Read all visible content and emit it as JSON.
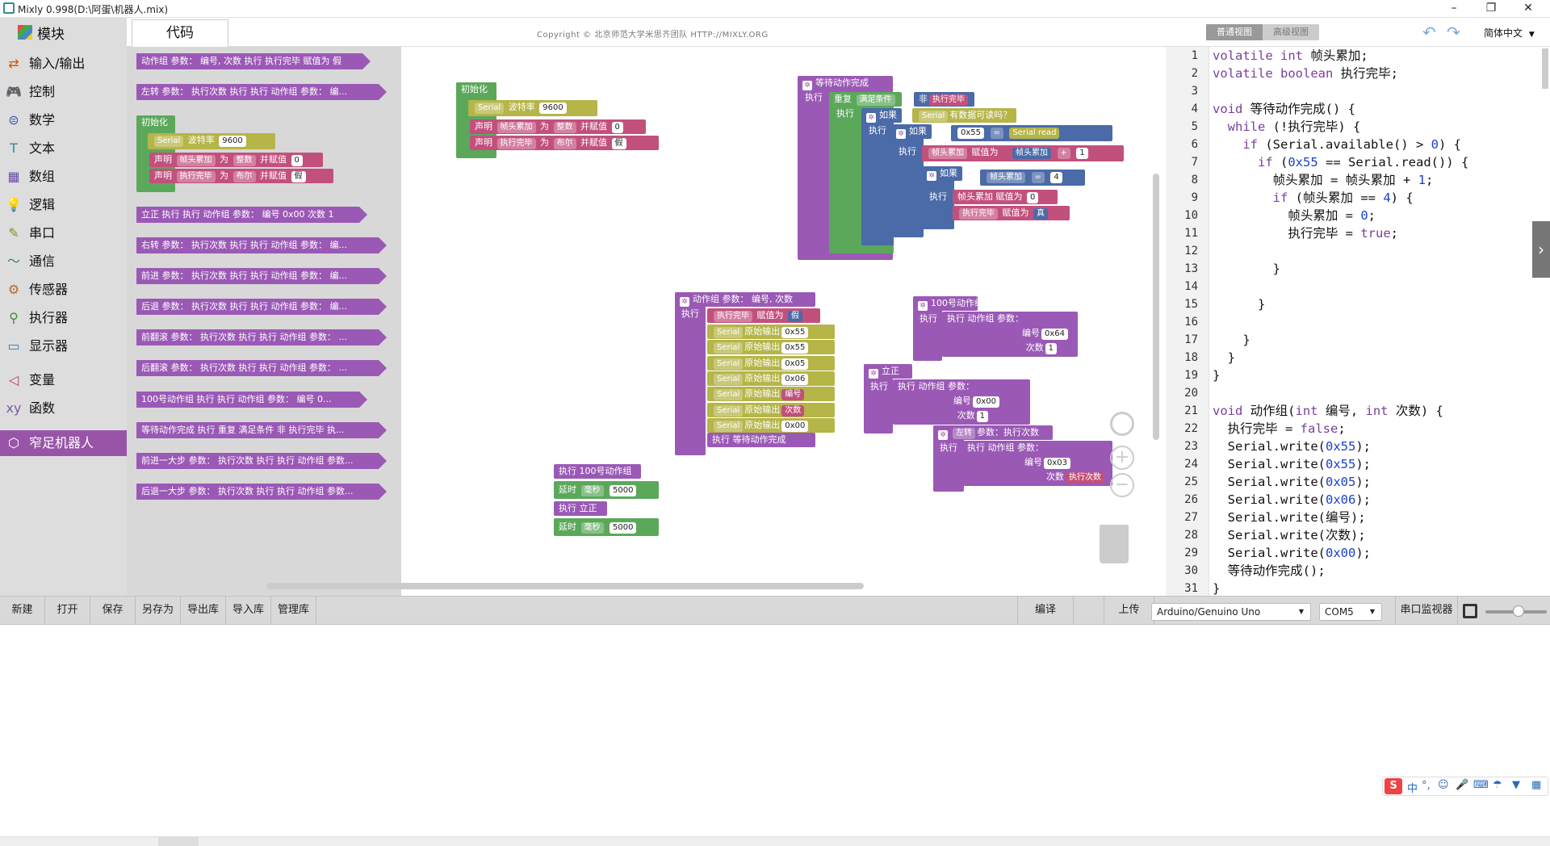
{
  "window": {
    "title": "Mixly 0.998(D:\\阿蛋\\机器人.mix)",
    "minimize": "–",
    "maximize": "❐",
    "close": "✕"
  },
  "tabs": {
    "blocks": "模块",
    "code": "代码",
    "copyright": "Copyright © 北京师范大学米思齐团队 HTTP://MIXLY.ORG",
    "normal_view": "普通视图",
    "advanced_view": "高级视图",
    "language": "简体中文"
  },
  "categories": [
    {
      "label": "输入/输出",
      "icon": "io-icon",
      "glyph": "⇄",
      "color": "#d35400"
    },
    {
      "label": "控制",
      "icon": "gamepad-icon",
      "glyph": "🎮",
      "color": "#3a8a3a"
    },
    {
      "label": "数学",
      "icon": "math-icon",
      "glyph": "⊜",
      "color": "#3a5aa8"
    },
    {
      "label": "文本",
      "icon": "text-icon",
      "glyph": "T",
      "color": "#3a8a8a"
    },
    {
      "label": "数组",
      "icon": "array-icon",
      "glyph": "▦",
      "color": "#6a4aa8"
    },
    {
      "label": "逻辑",
      "icon": "bulb-icon",
      "glyph": "💡",
      "color": "#3a6ab8"
    },
    {
      "label": "串口",
      "icon": "pen-icon",
      "glyph": "✎",
      "color": "#8a8a2a"
    },
    {
      "label": "通信",
      "icon": "wave-icon",
      "glyph": "〜",
      "color": "#2a8a5a"
    },
    {
      "label": "传感器",
      "icon": "sensor-icon",
      "glyph": "⚙",
      "color": "#b86a2a"
    },
    {
      "label": "执行器",
      "icon": "actuator-icon",
      "glyph": "⚲",
      "color": "#3a8a3a"
    },
    {
      "label": "显示器",
      "icon": "monitor-icon",
      "glyph": "▭",
      "color": "#3a7ab8"
    },
    {
      "label": "变量",
      "icon": "variable-icon",
      "glyph": "◁",
      "color": "#b83a5a"
    },
    {
      "label": "函数",
      "icon": "function-icon",
      "glyph": "xy",
      "color": "#7a5aa8"
    },
    {
      "label": "窄足机器人",
      "icon": "cube-icon",
      "glyph": "⬡",
      "color": "#ffffff"
    }
  ],
  "flyout": {
    "items": [
      "动作组 参数： 编号, 次数 执行 执行完毕 赋值为 假",
      "左转 参数： 执行次数 执行 执行 动作组 参数： 编...",
      "立正 执行 执行 动作组 参数： 编号 0x00 次数 1",
      "右转 参数： 执行次数 执行 执行 动作组 参数： 编...",
      "前进 参数： 执行次数 执行 执行 动作组 参数： 编...",
      "后退 参数： 执行次数 执行 执行 动作组 参数： 编...",
      "前翻滚 参数： 执行次数 执行 执行 动作组 参数： ...",
      "后翻滚 参数： 执行次数 执行 执行 动作组 参数： ...",
      "100号动作组 执行 执行 动作组 参数： 编号 0...",
      "等待动作完成 执行 重复 满足条件 非 执行完毕 执...",
      "前进一大步 参数： 执行次数 执行 执行 动作组 参数...",
      "后退一大步 参数： 执行次数 执行 执行 动作组 参数..."
    ],
    "init": {
      "title": "初始化",
      "serial": "Serial",
      "baud_label": "波特率",
      "baud": "9600",
      "declare1": "声明",
      "var1": "帧头累加",
      "as": "为",
      "type1": "整数",
      "assign": "并赋值",
      "val1": "0",
      "var2": "执行完毕",
      "type2": "布尔",
      "val2": "假"
    }
  },
  "workspace": {
    "init": {
      "title": "初始化",
      "serial": "Serial",
      "baud_label": "波特率",
      "baud": "9600",
      "declare": "声明",
      "var1": "帧头累加",
      "as": "为",
      "type1": "整数",
      "assign": "并赋值",
      "val1": "0",
      "var2": "执行完毕",
      "type2": "布尔",
      "val2": "假"
    },
    "wait": {
      "title": "等待动作完成",
      "exec": "执行",
      "repeat": "重复",
      "cond": "满足条件",
      "not": "非",
      "done": "执行完毕",
      "if": "如果",
      "serial": "Serial",
      "available": "有数据可读吗？",
      "hex55": "0x55",
      "eq": "=",
      "read": "read",
      "counter": "帧头累加",
      "assign_to": "赋值为",
      "plus": "+",
      "one": "1",
      "four": "4",
      "zero": "0",
      "true": "真"
    },
    "actiongroup": {
      "title": "动作组 参数： 编号, 次数",
      "exec": "执行",
      "done": "执行完毕",
      "assign_to": "赋值为",
      "false": "假",
      "serial": "Serial",
      "raw_out": "原始输出",
      "v1": "0x55",
      "v2": "0x55",
      "v3": "0x05",
      "v4": "0x06",
      "v5": "编号",
      "v6": "次数",
      "v7": "0x00",
      "wait": "执行 等待动作完成"
    },
    "g100": {
      "title": "100号动作组",
      "exec": "执行",
      "call": "执行 动作组 参数：",
      "id_label": "编号",
      "id": "0x64",
      "count_label": "次数",
      "count": "1"
    },
    "stand": {
      "title": "立正",
      "exec": "执行",
      "call": "执行 动作组 参数：",
      "id_label": "编号",
      "id": "0x00",
      "count_label": "次数",
      "count": "1"
    },
    "left": {
      "title": "左转",
      "params": "参数：执行次数",
      "exec": "执行",
      "call": "执行 动作组 参数：",
      "id_label": "编号",
      "id": "0x03",
      "count_label": "次数",
      "count": "执行次数"
    },
    "loose": {
      "exec100": "执行 100号动作组",
      "delay": "延时",
      "ms": "毫秒",
      "d1": "5000",
      "exec_stand": "执行 立正",
      "d2": "5000"
    }
  },
  "code": {
    "line_numbers": [
      "1",
      "2",
      "3",
      "4",
      "5",
      "6",
      "7",
      "8",
      "9",
      "10",
      "11",
      "12",
      "13",
      "14",
      "15",
      "16",
      "17",
      "18",
      "19",
      "20",
      "21",
      "22",
      "23",
      "24",
      "25",
      "26",
      "27",
      "28",
      "29",
      "30",
      "31"
    ],
    "lines": [
      "volatile int 帧头累加;",
      "volatile boolean 执行完毕;",
      "",
      "void 等待动作完成() {",
      "  while (!执行完毕) {",
      "    if (Serial.available() > 0) {",
      "      if (0x55 == Serial.read()) {",
      "        帧头累加 = 帧头累加 + 1;",
      "        if (帧头累加 == 4) {",
      "          帧头累加 = 0;",
      "          执行完毕 = true;",
      "",
      "        }",
      "",
      "      }",
      "",
      "    }",
      "  }",
      "}",
      "",
      "void 动作组(int 编号, int 次数) {",
      "  执行完毕 = false;",
      "  Serial.write(0x55);",
      "  Serial.write(0x55);",
      "  Serial.write(0x05);",
      "  Serial.write(0x06);",
      "  Serial.write(编号);",
      "  Serial.write(次数);",
      "  Serial.write(0x00);",
      "  等待动作完成();",
      "}"
    ]
  },
  "toolbar": {
    "new": "新建",
    "open": "打开",
    "save": "保存",
    "save_as": "另存为",
    "export_lib": "导出库",
    "import_lib": "导入库",
    "manage_lib": "管理库",
    "compile": "编译",
    "upload": "上传",
    "board": "Arduino/Genuino Uno",
    "port": "COM5",
    "serial_monitor": "串口监视器"
  },
  "ime": {
    "logo": "S",
    "mode": "中"
  }
}
